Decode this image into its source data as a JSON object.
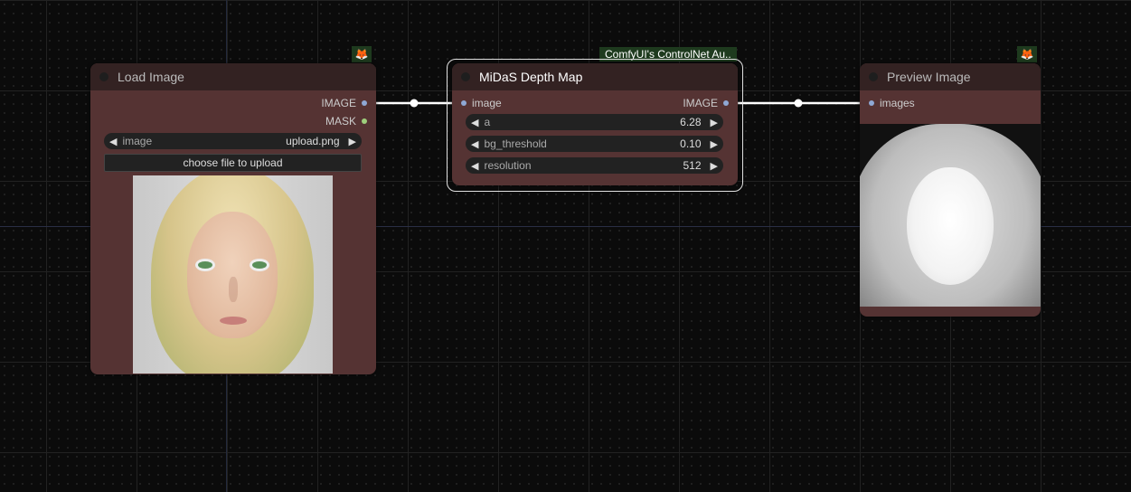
{
  "canvas": {
    "links_color": "#ffffff"
  },
  "nodes": {
    "load_image": {
      "title": "Load Image",
      "outputs": [
        "IMAGE",
        "MASK"
      ],
      "image_widget": {
        "label": "image",
        "value": "upload.png"
      },
      "upload_button": "choose file to upload",
      "badge_icon": "fox-icon",
      "preview_alt": "uploaded portrait of blonde woman with green eyes"
    },
    "midas": {
      "title": "MiDaS Depth Map",
      "group_tag": "ComfyUI's ControlNet Au..",
      "input": "image",
      "output": "IMAGE",
      "widgets": [
        {
          "label": "a",
          "value": "6.28"
        },
        {
          "label": "bg_threshold",
          "value": "0.10"
        },
        {
          "label": "resolution",
          "value": "512"
        }
      ]
    },
    "preview": {
      "title": "Preview Image",
      "input": "images",
      "badge_icon": "fox-icon",
      "preview_alt": "grayscale depth map of face"
    }
  },
  "colors": {
    "node_body": "#553333",
    "node_title": "#332222",
    "slot_image": "#8fa8d4",
    "slot_mask": "#9ecf7c",
    "tag_bg": "#1e3a1e"
  }
}
